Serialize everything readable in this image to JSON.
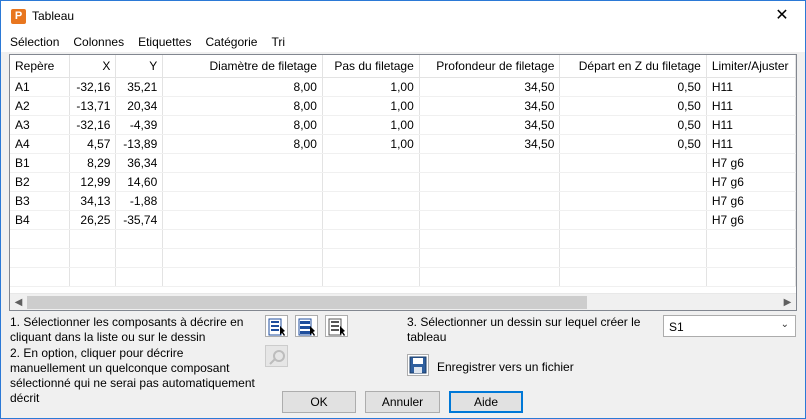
{
  "window": {
    "title": "Tableau",
    "app_icon_letter": "P",
    "close_glyph": "✕"
  },
  "menu": [
    "Sélection",
    "Colonnes",
    "Etiquettes",
    "Catégorie",
    "Tri"
  ],
  "grid": {
    "columns": [
      "Repère",
      "X",
      "Y",
      "Diamètre de filetage",
      "Pas du filetage",
      "Profondeur de filetage",
      "Départ en Z du filetage",
      "Limiter/Ajuster"
    ],
    "rows": [
      [
        "A1",
        "-32,16",
        "35,21",
        "8,00",
        "1,00",
        "34,50",
        "0,50",
        "H11"
      ],
      [
        "A2",
        "-13,71",
        "20,34",
        "8,00",
        "1,00",
        "34,50",
        "0,50",
        "H11"
      ],
      [
        "A3",
        "-32,16",
        "-4,39",
        "8,00",
        "1,00",
        "34,50",
        "0,50",
        "H11"
      ],
      [
        "A4",
        "4,57",
        "-13,89",
        "8,00",
        "1,00",
        "34,50",
        "0,50",
        "H11"
      ],
      [
        "B1",
        "8,29",
        "36,34",
        "",
        "",
        "",
        "",
        "H7 g6"
      ],
      [
        "B2",
        "12,99",
        "14,60",
        "",
        "",
        "",
        "",
        "H7 g6"
      ],
      [
        "B3",
        "34,13",
        "-1,88",
        "",
        "",
        "",
        "",
        "H7 g6"
      ],
      [
        "B4",
        "26,25",
        "-35,74",
        "",
        "",
        "",
        "",
        "H7 g6"
      ],
      [
        "",
        "",
        "",
        "",
        "",
        "",
        "",
        ""
      ],
      [
        "",
        "",
        "",
        "",
        "",
        "",
        "",
        ""
      ],
      [
        "",
        "",
        "",
        "",
        "",
        "",
        "",
        ""
      ]
    ]
  },
  "instructions": {
    "step1": "1. Sélectionner les composants à décrire en cliquant dans la liste ou sur le dessin",
    "step2": "2. En option, cliquer pour décrire manuellement un quelconque composant sélectionné qui ne serai pas automatiquement décrit",
    "step3": "3. Sélectionner un dessin sur lequel créer le tableau"
  },
  "drawing_select": {
    "value": "S1"
  },
  "save_label": "Enregistrer vers un fichier",
  "buttons": {
    "ok": "OK",
    "cancel": "Annuler",
    "help": "Aide"
  },
  "colors": {
    "accent": "#0078d7",
    "app_icon": "#e8761f"
  }
}
